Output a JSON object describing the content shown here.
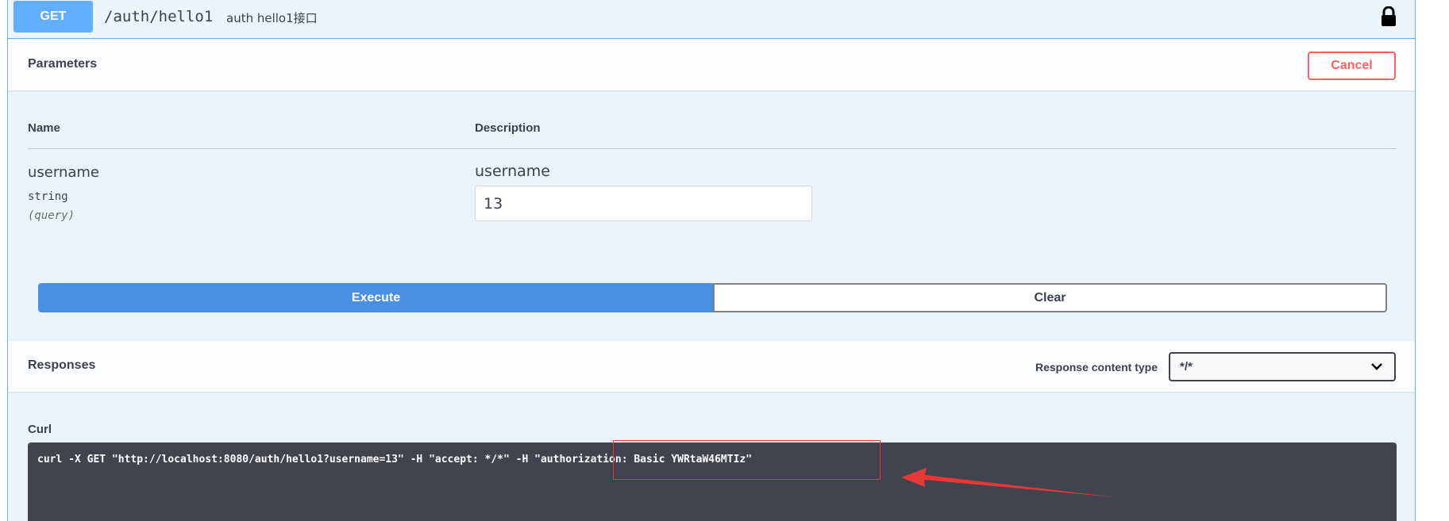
{
  "operation": {
    "method": "GET",
    "path": "/auth/hello1",
    "description": "auth hello1接口",
    "lock_icon": "lock-icon"
  },
  "parameters": {
    "title": "Parameters",
    "cancel_label": "Cancel",
    "col_name": "Name",
    "col_description": "Description",
    "items": [
      {
        "name": "username",
        "type": "string",
        "in": "(query)",
        "description": "username",
        "value": "13"
      }
    ]
  },
  "actions": {
    "execute_label": "Execute",
    "clear_label": "Clear"
  },
  "responses": {
    "title": "Responses",
    "content_type_label": "Response content type",
    "content_type_value": "*/*"
  },
  "curl": {
    "label": "Curl",
    "command": "curl -X GET \"http://localhost:8080/auth/hello1?username=13\" -H \"accept: */*\" -H \"authorization: Basic YWRtaW46MTIz\""
  },
  "colors": {
    "get_blue": "#61affe",
    "execute_blue": "#4990e2",
    "cancel_red": "#ff6060",
    "curl_bg": "#41444e",
    "annotation_red": "#e53935"
  }
}
